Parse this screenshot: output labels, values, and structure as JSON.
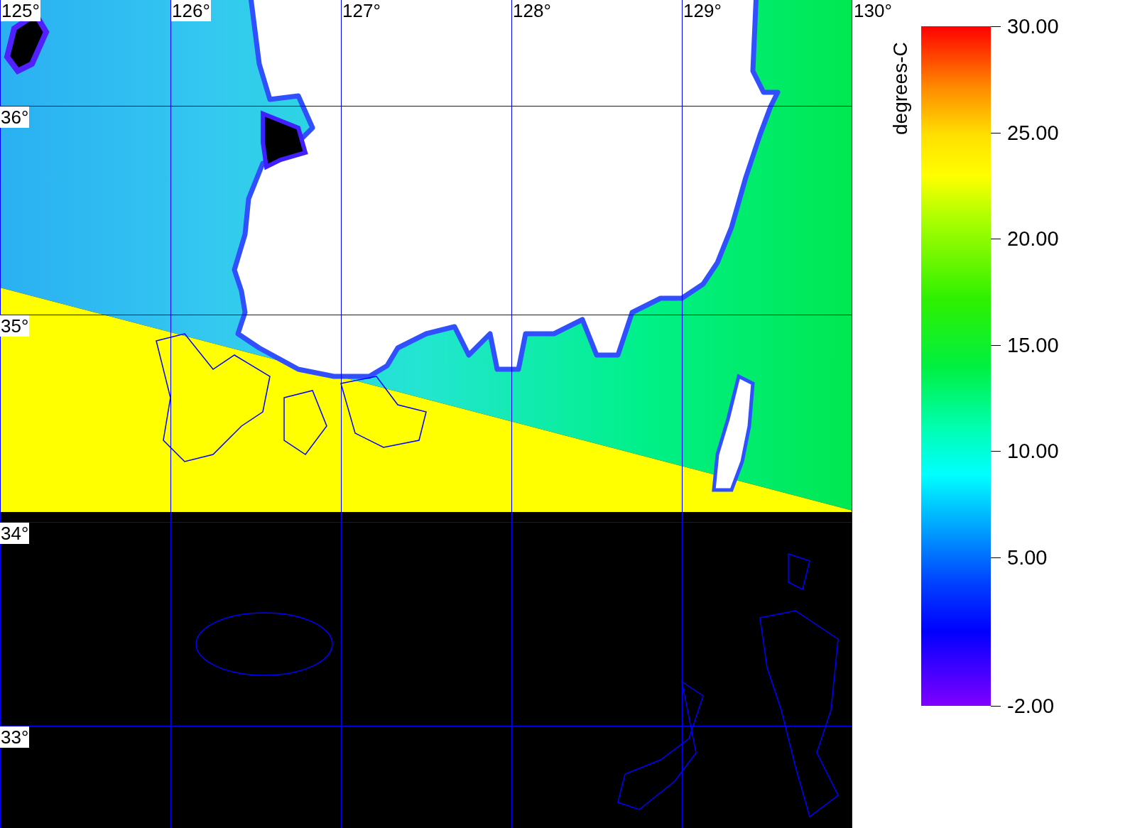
{
  "map": {
    "longitude_labels": [
      "125°",
      "126°",
      "127°",
      "128°",
      "129°",
      "130°"
    ],
    "latitude_labels": [
      "36°",
      "35°",
      "34°",
      "33°"
    ]
  },
  "color_scale": {
    "title": "degrees-C",
    "tick_labels": [
      "30.00",
      "25.00",
      "20.00",
      "15.00",
      "10.00",
      "5.00",
      "-2.00"
    ]
  }
}
